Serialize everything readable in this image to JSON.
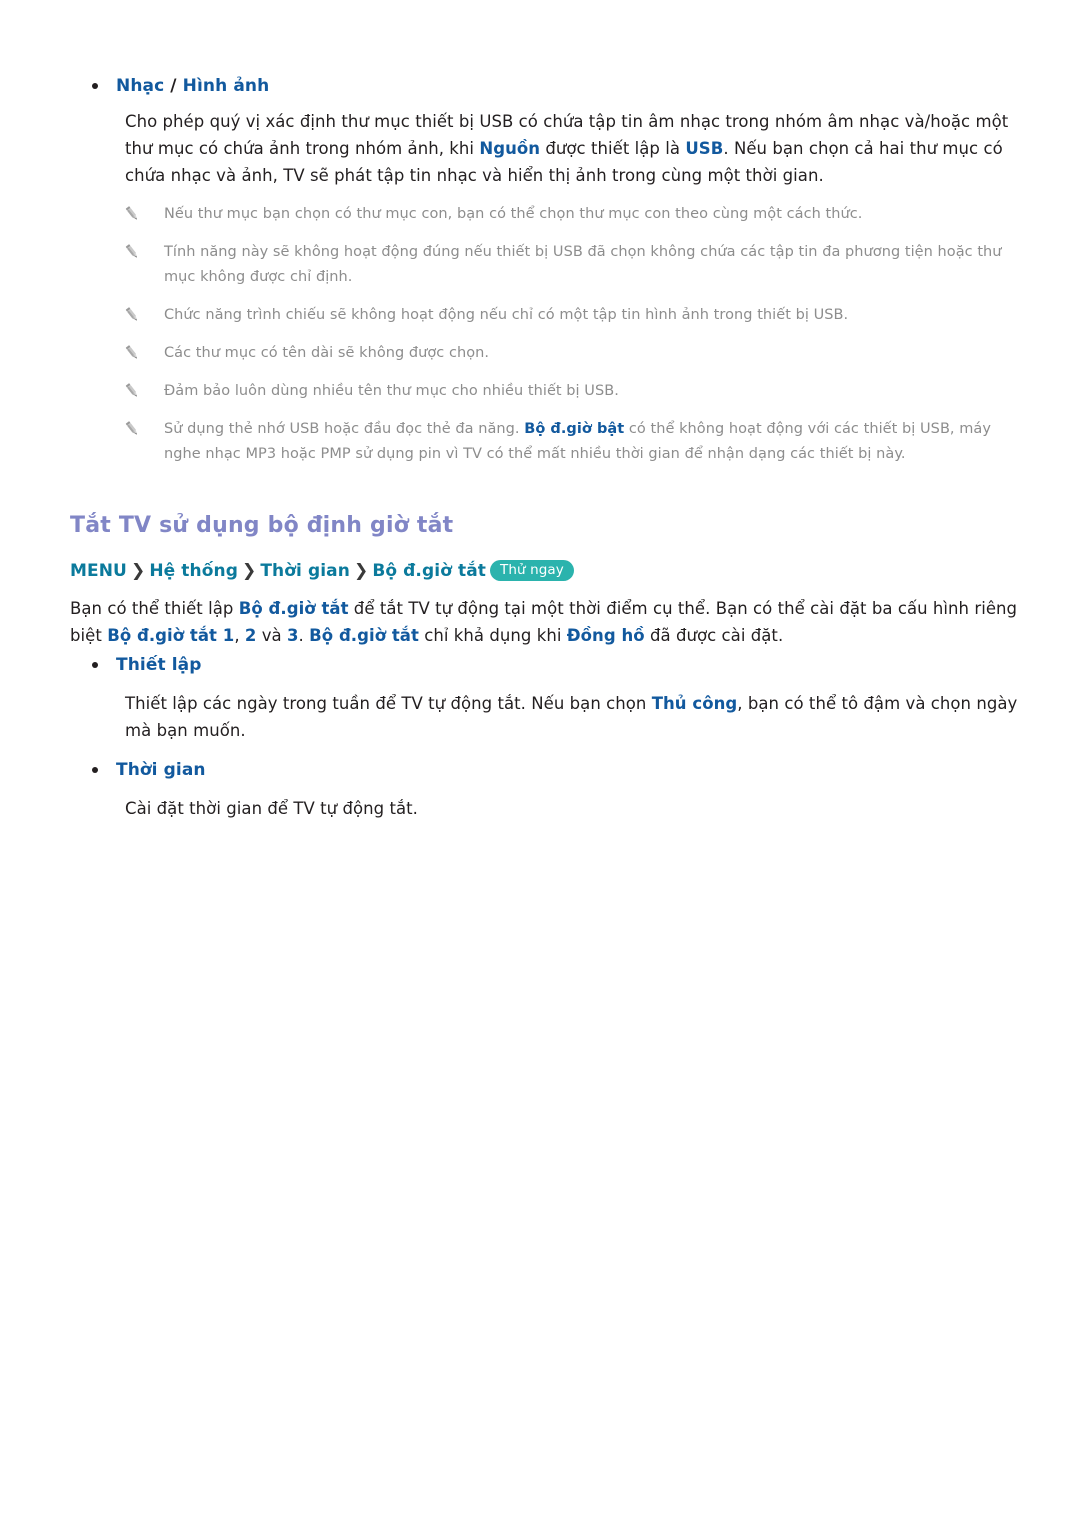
{
  "page": {
    "background": "#ffffff",
    "accent_blue": "#12599e",
    "accent_teal": "#0b7a9c",
    "accent_purple": "#8186c6",
    "badge_bg": "#2bb3ad",
    "note_text": "#8d8d8d"
  },
  "music_picture": {
    "bullet_label_1": "Nhạc",
    "bullet_separator": " / ",
    "bullet_label_2": "Hình ảnh",
    "paragraph": {
      "part1": "Cho phép quý vị xác định thư mục thiết bị USB có chứa tập tin âm nhạc trong nhóm âm nhạc và/hoặc một thư mục có chứa ảnh trong nhóm ảnh, khi ",
      "term1": "Nguồn",
      "part2": " được thiết lập là ",
      "term2": "USB",
      "part3": ". Nếu bạn chọn cả hai thư mục có chứa nhạc và ảnh, TV sẽ phát tập tin nhạc và hiển thị ảnh trong cùng một thời gian."
    }
  },
  "notes": {
    "icon": "pencil-icon",
    "items": [
      {
        "text": "Nếu thư mục bạn chọn có thư mục con, bạn có thể chọn thư mục con theo cùng một cách thức."
      },
      {
        "text": "Tính năng này sẽ không hoạt động đúng nếu thiết bị USB đã chọn không chứa các tập tin đa phương tiện hoặc thư mục không được chỉ định."
      },
      {
        "text": "Chức năng trình chiếu sẽ không hoạt động nếu chỉ có một tập tin hình ảnh trong thiết bị USB."
      },
      {
        "text": "Các thư mục có tên dài sẽ không được chọn."
      },
      {
        "text": "Đảm bảo luôn dùng nhiều tên thư mục cho nhiều thiết bị USB."
      },
      {
        "part1": "Sử dụng thẻ nhớ USB hoặc đầu đọc thẻ đa năng. ",
        "term1": "Bộ đ.giờ bật",
        "part2": " có thể không hoạt động với các thiết bị USB, máy nghe nhạc MP3 hoặc PMP sử dụng pin vì TV có thể mất nhiều thời gian để nhận dạng các thiết bị này."
      }
    ]
  },
  "section": {
    "title": "Tắt TV sử dụng bộ định giờ tắt",
    "breadcrumb": {
      "separator": "❯",
      "items": [
        "MENU",
        "Hệ thống",
        "Thời gian",
        "Bộ đ.giờ tắt"
      ],
      "badge": "Thử ngay"
    },
    "paragraph": {
      "part1": "Bạn có thể thiết lập ",
      "term1": "Bộ đ.giờ tắt",
      "part2": " để tắt TV tự động tại một thời điểm cụ thể. Bạn có thể cài đặt ba cấu hình riêng biệt ",
      "term2": "Bộ đ.giờ tắt 1",
      "part3": ", ",
      "term3": "2",
      "part4": " và ",
      "term4": "3",
      "part5": ". ",
      "term5": "Bộ đ.giờ tắt",
      "part6": " chỉ khả dụng khi ",
      "term6": "Đồng hồ",
      "part7": " đã được cài đặt."
    },
    "subsections": [
      {
        "heading": "Thiết lập",
        "body": {
          "part1": "Thiết lập các ngày trong tuần để TV tự động tắt. Nếu bạn chọn ",
          "term1": "Thủ công",
          "part2": ", bạn có thể tô đậm và chọn ngày mà bạn muốn."
        }
      },
      {
        "heading": "Thời gian",
        "body": {
          "part1": "Cài đặt thời gian để TV tự động tắt."
        }
      }
    ]
  }
}
